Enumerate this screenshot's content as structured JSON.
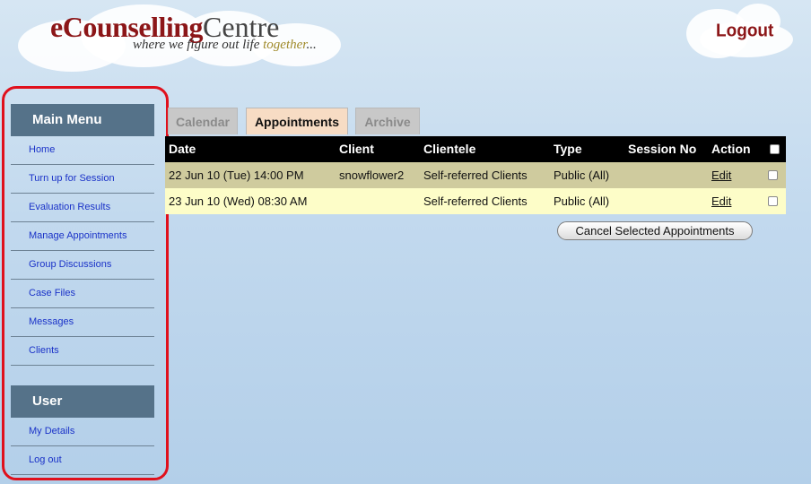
{
  "header": {
    "brand_part1": "eCounselling",
    "brand_part2": "Centre",
    "tagline_main": "where we figure out life ",
    "tagline_highlight": "together",
    "tagline_end": "...",
    "logout_label": "Logout"
  },
  "sidebar": {
    "main_menu_title": "Main Menu",
    "main_items": [
      "Home",
      "Turn up for Session",
      "Evaluation Results",
      "Manage Appointments",
      "Group Discussions",
      "Case Files",
      "Messages",
      "Clients"
    ],
    "user_title": "User",
    "user_items": [
      "My Details",
      "Log out"
    ]
  },
  "tabs": [
    "Calendar",
    "Appointments",
    "Archive"
  ],
  "active_tab": "Appointments",
  "table": {
    "columns": [
      "Date",
      "Client",
      "Clientele",
      "Type",
      "Session No",
      "Action"
    ],
    "rows": [
      {
        "date": "22 Jun 10 (Tue) 14:00 PM",
        "client": "snowflower2",
        "clientele": "Self-referred Clients",
        "type": "Public (All)",
        "session_no": "",
        "action": "Edit"
      },
      {
        "date": "23 Jun 10 (Wed) 08:30 AM",
        "client": "",
        "clientele": "Self-referred Clients",
        "type": "Public (All)",
        "session_no": "",
        "action": "Edit"
      }
    ]
  },
  "cancel_button_label": "Cancel Selected Appointments",
  "colors": {
    "brand_red": "#8c1618",
    "menu_header": "#557289",
    "row_odd": "#cfcb9e",
    "row_even": "#fdfdc8",
    "highlight_border": "#e0101c",
    "active_tab": "#f7dcc4"
  }
}
